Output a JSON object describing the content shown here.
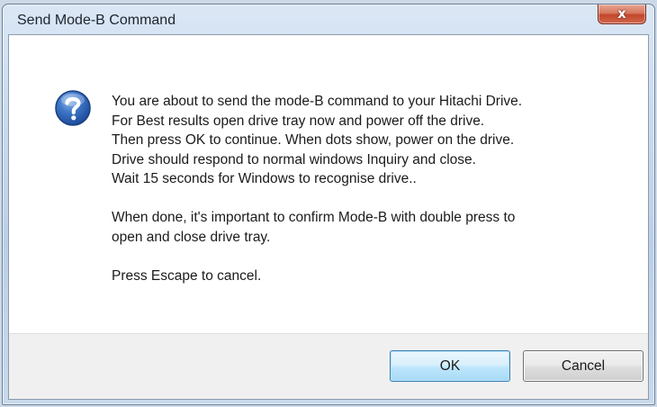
{
  "dialog": {
    "title": "Send Mode-B Command",
    "close_symbol": "x",
    "icon": "question-icon",
    "message_paragraphs": [
      "You are about to send the mode-B command to your Hitachi Drive.\nFor Best results open drive tray now and power off the drive.\nThen press OK to continue. When dots show, power on the drive.\nDrive should respond to normal windows Inquiry and close.\nWait 15 seconds for Windows to recognise drive..",
      "When done, it's important to confirm Mode-B with double press to\nopen and close drive tray.",
      "Press Escape to cancel."
    ],
    "buttons": {
      "ok_label": "OK",
      "cancel_label": "Cancel"
    }
  },
  "colors": {
    "title_bar": "#c9daee",
    "close_button": "#c3462a",
    "icon_blue": "#2f63b6",
    "footer_background": "#f0f0f0",
    "default_button_border": "#3c7fb1"
  }
}
